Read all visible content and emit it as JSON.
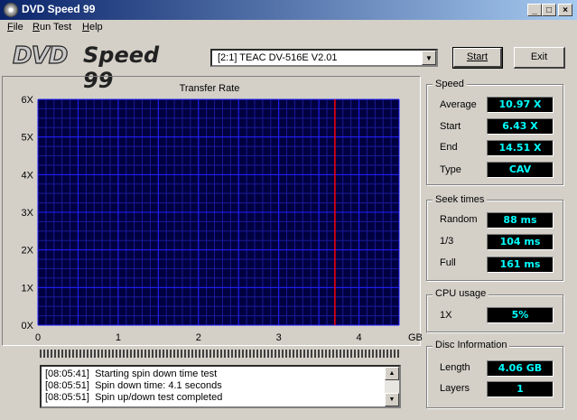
{
  "window": {
    "title": "DVD Speed 99"
  },
  "menu": [
    "File",
    "Run Test",
    "Help"
  ],
  "logo": {
    "dvd": "DVD",
    "speed": "Speed 99"
  },
  "drive": {
    "selected": "[2:1]   TEAC DV-516E V2.01"
  },
  "buttons": {
    "start": "Start",
    "exit": "Exit"
  },
  "chart_data": {
    "type": "line",
    "title": "Transfer Rate",
    "y_ticks": [
      "6X",
      "5X",
      "4X",
      "3X",
      "2X",
      "1X",
      "0X"
    ],
    "x_ticks": [
      "0",
      "1",
      "2",
      "3",
      "4"
    ],
    "x_unit": "GB",
    "xlim": [
      0,
      4.5
    ],
    "ylim": [
      0,
      6
    ],
    "marker_x": 3.7,
    "series": [],
    "colors": {
      "background": "#000040",
      "grid": "#2020ff",
      "marker": "#ff0000"
    }
  },
  "log": [
    {
      "time": "[08:05:41]",
      "msg": "Starting spin down time test"
    },
    {
      "time": "[08:05:51]",
      "msg": "Spin down time: 4.1 seconds"
    },
    {
      "time": "[08:05:51]",
      "msg": "Spin up/down test completed"
    }
  ],
  "speed": {
    "title": "Speed",
    "average_label": "Average",
    "average": "10.97 X",
    "start_label": "Start",
    "start": "6.43 X",
    "end_label": "End",
    "end": "14.51 X",
    "type_label": "Type",
    "type": "CAV"
  },
  "seek": {
    "title": "Seek times",
    "random_label": "Random",
    "random": "88 ms",
    "third_label": "1/3",
    "third": "104 ms",
    "full_label": "Full",
    "full": "161 ms"
  },
  "cpu": {
    "title": "CPU usage",
    "label": "1X",
    "value": "5%"
  },
  "disc": {
    "title": "Disc Information",
    "length_label": "Length",
    "length": "4.06 GB",
    "layers_label": "Layers",
    "layers": "1"
  }
}
